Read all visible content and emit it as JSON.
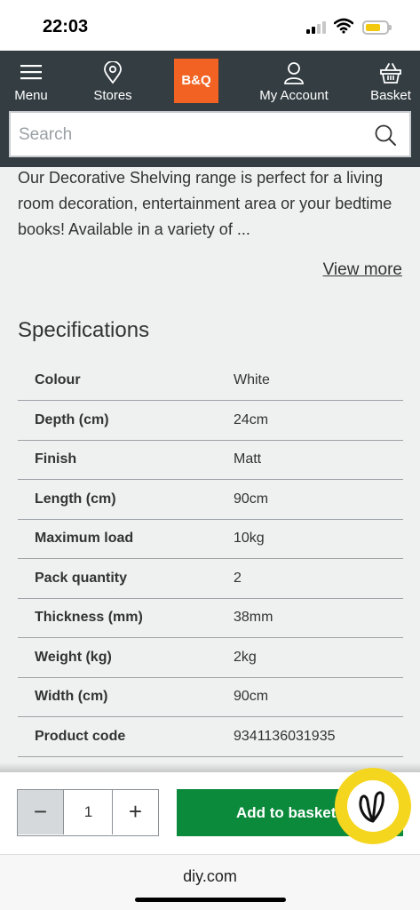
{
  "status_bar": {
    "time": "22:03"
  },
  "header": {
    "nav": [
      {
        "label": "Menu",
        "icon": "hamburger-menu-icon"
      },
      {
        "label": "Stores",
        "icon": "location-pin-icon"
      },
      {
        "label": "My Account",
        "icon": "user-icon"
      },
      {
        "label": "Basket",
        "icon": "basket-icon"
      }
    ],
    "logo_text": "B&Q",
    "search": {
      "placeholder": "Search",
      "value": ""
    }
  },
  "description": {
    "text": "Our  Decorative Shelving range is perfect for a living room decoration, entertainment area or your bedtime books! Available in a variety of ...",
    "view_more": "View more"
  },
  "specifications": {
    "title": "Specifications",
    "rows": [
      {
        "key": "Colour",
        "value": "White"
      },
      {
        "key": "Depth (cm)",
        "value": "24cm"
      },
      {
        "key": "Finish",
        "value": "Matt"
      },
      {
        "key": "Length (cm)",
        "value": "90cm"
      },
      {
        "key": "Maximum load",
        "value": "10kg"
      },
      {
        "key": "Pack quantity",
        "value": "2"
      },
      {
        "key": "Thickness (mm)",
        "value": "38mm"
      },
      {
        "key": "Weight (kg)",
        "value": "2kg"
      },
      {
        "key": "Width (cm)",
        "value": "90cm"
      },
      {
        "key": "Product code",
        "value": "9341136031935"
      }
    ]
  },
  "purchase": {
    "minus": "−",
    "quantity": "1",
    "plus": "+",
    "add_label": "Add to basket"
  },
  "browser": {
    "url": "diy.com"
  },
  "colors": {
    "brand_orange": "#f26323",
    "header_bg": "#333d42",
    "add_green": "#0a8a3a",
    "chat_yellow": "#f5d61f"
  }
}
